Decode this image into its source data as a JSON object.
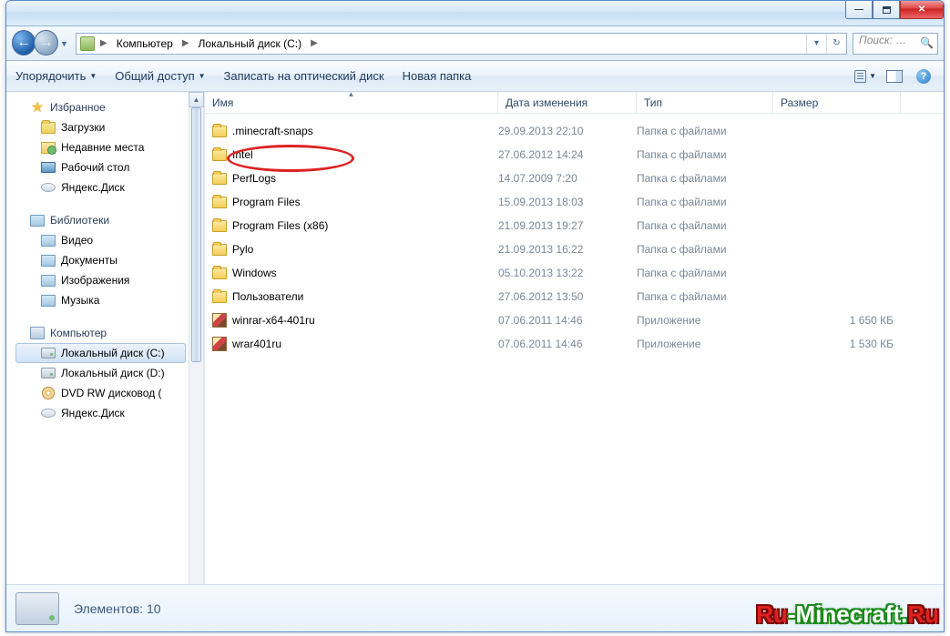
{
  "breadcrumb": {
    "node1": "Компьютер",
    "node2": "Локальный диск (C:)"
  },
  "search": {
    "placeholder": "Поиск: …"
  },
  "toolbar": {
    "organize": "Упорядочить",
    "share": "Общий доступ",
    "burn": "Записать на оптический диск",
    "newfolder": "Новая папка"
  },
  "sidebar": {
    "favorites": {
      "header": "Избранное",
      "items": [
        "Загрузки",
        "Недавние места",
        "Рабочий стол",
        "Яндекс.Диск"
      ]
    },
    "libraries": {
      "header": "Библиотеки",
      "items": [
        "Видео",
        "Документы",
        "Изображения",
        "Музыка"
      ]
    },
    "computer": {
      "header": "Компьютер",
      "items": [
        "Локальный диск (C:)",
        "Локальный диск (D:)",
        "DVD RW дисковод (",
        "Яндекс.Диск"
      ]
    }
  },
  "columns": {
    "name": "Имя",
    "date": "Дата изменения",
    "type": "Тип",
    "size": "Размер"
  },
  "rows": [
    {
      "icon": "folder",
      "name": ".minecraft-snaps",
      "date": "29.09.2013 22:10",
      "type": "Папка с файлами",
      "size": ""
    },
    {
      "icon": "folder",
      "name": "Intel",
      "date": "27.06.2012 14:24",
      "type": "Папка с файлами",
      "size": ""
    },
    {
      "icon": "folder",
      "name": "PerfLogs",
      "date": "14.07.2009 7:20",
      "type": "Папка с файлами",
      "size": ""
    },
    {
      "icon": "folder",
      "name": "Program Files",
      "date": "15.09.2013 18:03",
      "type": "Папка с файлами",
      "size": ""
    },
    {
      "icon": "folder",
      "name": "Program Files (x86)",
      "date": "21.09.2013 19:27",
      "type": "Папка с файлами",
      "size": ""
    },
    {
      "icon": "folder",
      "name": "Pylo",
      "date": "21.09.2013 16:22",
      "type": "Папка с файлами",
      "size": ""
    },
    {
      "icon": "folder",
      "name": "Windows",
      "date": "05.10.2013 13:22",
      "type": "Папка с файлами",
      "size": ""
    },
    {
      "icon": "folder",
      "name": "Пользователи",
      "date": "27.06.2012 13:50",
      "type": "Папка с файлами",
      "size": ""
    },
    {
      "icon": "exe",
      "name": "winrar-x64-401ru",
      "date": "07.06.2011 14:46",
      "type": "Приложение",
      "size": "1 650 КБ"
    },
    {
      "icon": "exe",
      "name": "wrar401ru",
      "date": "07.06.2011 14:46",
      "type": "Приложение",
      "size": "1 530 КБ"
    }
  ],
  "status": {
    "text": "Элементов: 10"
  },
  "watermark": {
    "part1": "Ru",
    "part2": "-Minecraft.",
    "part3": "Ru"
  }
}
